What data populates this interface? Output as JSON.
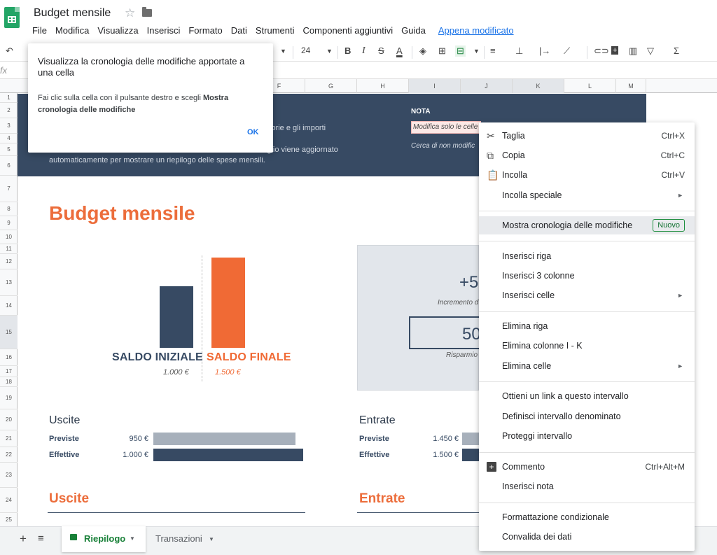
{
  "app": {
    "doc_title": "Budget mensile",
    "menu": [
      "File",
      "Modifica",
      "Visualizza",
      "Inserisci",
      "Formato",
      "Dati",
      "Strumenti",
      "Componenti aggiuntivi",
      "Guida"
    ],
    "last_edit": "Appena modificato"
  },
  "toolbar": {
    "font_size": "24",
    "fx_label": "fx"
  },
  "columns": [
    "F",
    "G",
    "H",
    "I",
    "J",
    "K",
    "L",
    "M"
  ],
  "rows": [
    "1",
    "2",
    "3",
    "4",
    "5",
    "6",
    "7",
    "8",
    "9",
    "10",
    "11",
    "12",
    "13",
    "14",
    "15",
    "16",
    "17",
    "18",
    "19",
    "20",
    "21",
    "22",
    "23",
    "24",
    "25"
  ],
  "sheet": {
    "banner_left_1": "...tegorie e gli importi",
    "banner_left_2": "...foglio viene aggiornato",
    "banner_left_3": "automaticamente per mostrare un riepilogo delle spese mensili.",
    "note_heading": "NOTA",
    "note_line_1": "Modifica solo le celle",
    "note_line_2": "Cerca di non modific",
    "title": "Budget mensile",
    "chart": {
      "initial_label": "SALDO INIZIALE",
      "initial_value": "1.000 €",
      "final_label": "SALDO FINALE",
      "final_value": "1.500 €"
    },
    "summary": {
      "increment_value": "+5",
      "increment_label": "Incremento d",
      "savings_value": "50",
      "savings_label": "Risparmio"
    },
    "expenses": {
      "heading": "Uscite",
      "planned_label": "Previste",
      "planned_value": "950 €",
      "actual_label": "Effettive",
      "actual_value": "1.000 €",
      "section_title": "Uscite"
    },
    "income": {
      "heading": "Entrate",
      "planned_label": "Previste",
      "planned_value": "1.450 €",
      "actual_label": "Effettive",
      "actual_value": "1.500 €",
      "section_title": "Entrate"
    }
  },
  "tabs": {
    "active": "Riepilogo",
    "other": "Transazioni"
  },
  "tooltip": {
    "title": "Visualizza la cronologia delle modifiche apportate a una cella",
    "body_prefix": "Fai clic sulla cella con il pulsante destro e scegli ",
    "body_bold": "Mostra cronologia delle modifiche",
    "ok": "OK"
  },
  "context_menu": {
    "cut": "Taglia",
    "cut_sc": "Ctrl+X",
    "copy": "Copia",
    "copy_sc": "Ctrl+C",
    "paste": "Incolla",
    "paste_sc": "Ctrl+V",
    "paste_special": "Incolla speciale",
    "history": "Mostra cronologia delle modifiche",
    "new_badge": "Nuovo",
    "insert_row": "Inserisci riga",
    "insert_cols": "Inserisci 3 colonne",
    "insert_cells": "Inserisci celle",
    "delete_row": "Elimina riga",
    "delete_cols": "Elimina colonne I - K",
    "delete_cells": "Elimina celle",
    "get_link": "Ottieni un link a questo intervallo",
    "named_range": "Definisci intervallo denominato",
    "protect": "Proteggi intervallo",
    "comment": "Commento",
    "comment_sc": "Ctrl+Alt+M",
    "insert_note": "Inserisci nota",
    "cond_format": "Formattazione condizionale",
    "validation": "Convalida dei dati"
  },
  "colors": {
    "navy": "#374a63",
    "orange": "#f06a35",
    "sheets_green": "#23a566"
  },
  "chart_data": {
    "type": "bar",
    "categories": [
      "SALDO INIZIALE",
      "SALDO FINALE"
    ],
    "values": [
      1000,
      1500
    ]
  }
}
